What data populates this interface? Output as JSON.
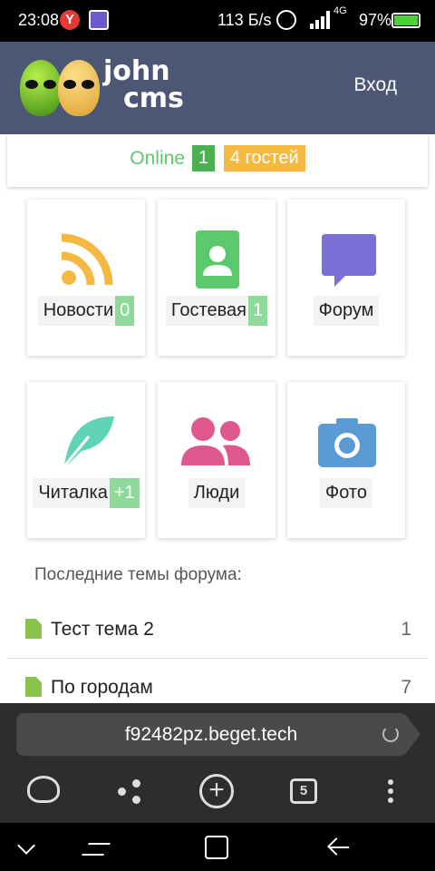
{
  "status_bar": {
    "time": "23:08",
    "network_speed": "113 Б/s",
    "network_type": "4G",
    "battery": "97%"
  },
  "header": {
    "logo_line1": "john",
    "logo_line2": "cms",
    "login_label": "Вход"
  },
  "online": {
    "label": "Online",
    "count": "1",
    "guests": "4 гостей"
  },
  "tiles": [
    {
      "label": "Новости",
      "count": "0",
      "icon": "rss-icon",
      "color": "#f5b942"
    },
    {
      "label": "Гостевая",
      "count": "1",
      "icon": "contact-card-icon",
      "color": "#5cc96c"
    },
    {
      "label": "Форум",
      "count": "",
      "icon": "chat-bubble-icon",
      "color": "#7b6fd6"
    },
    {
      "label": "Читалка",
      "count": "+1",
      "icon": "feather-icon",
      "color": "#5ed3b5"
    },
    {
      "label": "Люди",
      "count": "",
      "icon": "people-icon",
      "color": "#e0578e"
    },
    {
      "label": "Фото",
      "count": "",
      "icon": "camera-icon",
      "color": "#5b9bd5"
    }
  ],
  "forum": {
    "title": "Последние темы форума:",
    "topics": [
      {
        "name": "Тест тема 2",
        "count": "1"
      },
      {
        "name": "По городам",
        "count": "7"
      }
    ]
  },
  "browser": {
    "url": "f92482pz.beget.tech",
    "tab_count": "5"
  }
}
